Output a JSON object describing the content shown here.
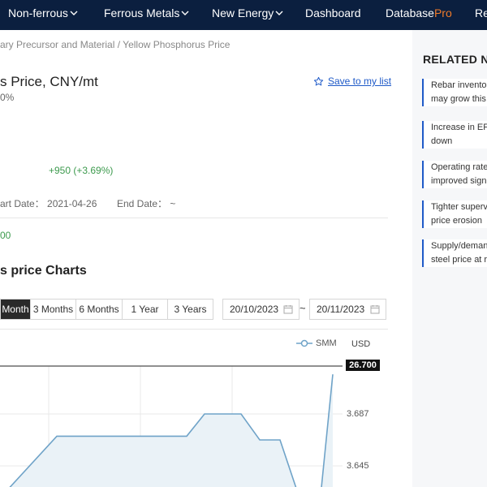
{
  "nav": {
    "items": [
      {
        "label": "Non-ferrous",
        "dropdown": true
      },
      {
        "label": "Ferrous Metals",
        "dropdown": true
      },
      {
        "label": "New Energy",
        "dropdown": true
      },
      {
        "label": "Dashboard",
        "dropdown": false
      },
      {
        "label_main": "Database",
        "label_accent": "Pro",
        "dropdown": false
      },
      {
        "label": "Re",
        "dropdown": false
      }
    ],
    "background": "#0b1f3f",
    "accent": "#f07b2a"
  },
  "breadcrumb": "ary Precursor and Material / Yellow Phosphorus Price",
  "product": {
    "title": "s Price, CNY/mt",
    "percent_fragment": "0%",
    "save_label": "Save to my list",
    "change": "+950 (+3.69%)",
    "start_date": "art Date： 2021-04-26",
    "end_date": "End Date： ~",
    "value_fragment": "00"
  },
  "charts_title": "s price Charts",
  "range_tabs": [
    {
      "label": "Month",
      "active": true
    },
    {
      "label": "3 Months",
      "active": false
    },
    {
      "label": "6 Months",
      "active": false
    },
    {
      "label": "1 Year",
      "active": false
    },
    {
      "label": "3 Years",
      "active": false
    }
  ],
  "date_range": {
    "from": "20/10/2023",
    "separator": "~",
    "to": "20/11/2023"
  },
  "related": {
    "title": "RELATED NE",
    "items": [
      {
        "line1": "Rebar inventor",
        "line2": "may grow this"
      },
      {
        "line1": "Increase in EF",
        "line2": "down"
      },
      {
        "line1": "Operating rate",
        "line2": "improved sign"
      },
      {
        "line1": "Tighter superv",
        "line2": "price erosion"
      },
      {
        "line1": "Supply/deman",
        "line2": "steel price at r"
      }
    ]
  },
  "chart_data": {
    "type": "area",
    "legend": "SMM",
    "unit": "USD",
    "current_value_label": "26.700",
    "y_tick_labels": [
      "3.687",
      "3.645"
    ],
    "series": [
      {
        "name": "SMM",
        "points": [
          [
            0,
            3.619
          ],
          [
            1,
            3.669
          ],
          [
            2,
            3.669
          ],
          [
            3,
            3.669
          ],
          [
            4,
            3.669
          ],
          [
            5,
            3.687
          ],
          [
            6,
            3.687
          ],
          [
            7,
            3.666
          ],
          [
            8,
            3.666
          ],
          [
            9,
            3.621
          ],
          [
            10,
            3.621
          ],
          [
            11,
            3.719
          ]
        ]
      }
    ],
    "colors": {
      "line": "#6fa3c8",
      "fill": "#eaf2f7"
    }
  }
}
